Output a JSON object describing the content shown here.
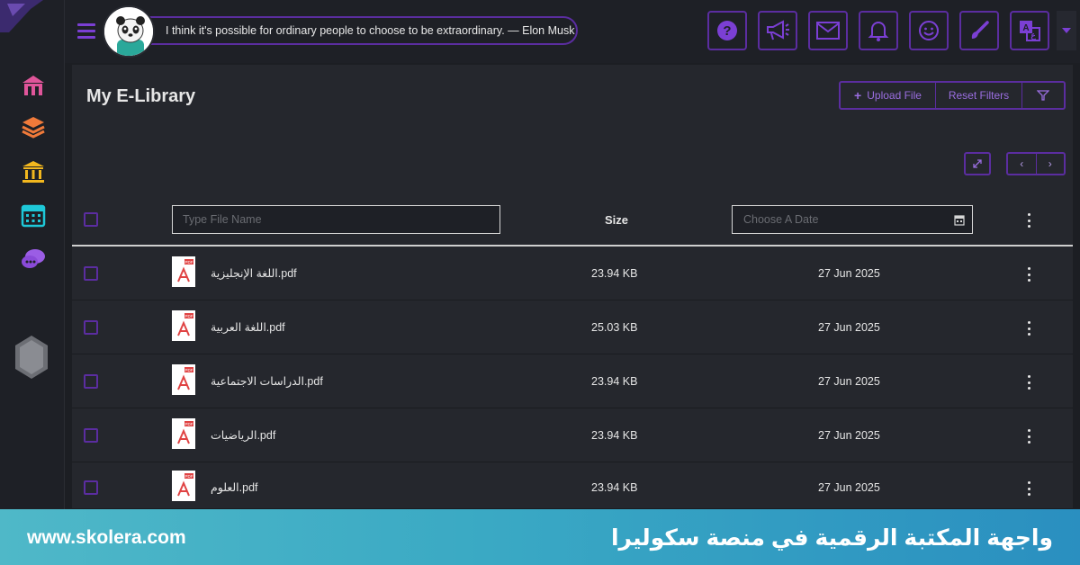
{
  "topbar": {
    "quote": "I think it's possible for ordinary people to choose to be extraordinary. — Elon Musk",
    "icons": [
      "help-icon",
      "megaphone-icon",
      "mail-icon",
      "bell-icon",
      "smiley-icon",
      "brush-icon",
      "translate-icon"
    ]
  },
  "sidebar": {
    "items": [
      "home-icon",
      "layers-icon",
      "institution-icon",
      "calendar-icon",
      "chat-icon"
    ]
  },
  "library": {
    "title": "My E-Library",
    "upload_label": "Upload File",
    "reset_label": "Reset Filters",
    "pager_prev": "‹",
    "pager_next": "›",
    "name_placeholder": "Type File Name",
    "size_header": "Size",
    "date_placeholder": "Choose A Date",
    "rows": [
      {
        "name": "اللغة الإنجليزية.pdf",
        "size": "23.94 KB",
        "date": "27 Jun 2025"
      },
      {
        "name": "اللغة العربية.pdf",
        "size": "25.03 KB",
        "date": "27 Jun 2025"
      },
      {
        "name": "الدراسات الاجتماعية.pdf",
        "size": "23.94 KB",
        "date": "27 Jun 2025"
      },
      {
        "name": "الرياضيات.pdf",
        "size": "23.94 KB",
        "date": "27 Jun 2025"
      },
      {
        "name": "العلوم.pdf",
        "size": "23.94 KB",
        "date": "27 Jun 2025"
      }
    ]
  },
  "banner": {
    "url": "www.skolera.com",
    "title": "واجهة المكتبة الرقمية في منصة سكوليرا"
  },
  "colors": {
    "accent": "#5b2da0",
    "accent_light": "#9a6ee0",
    "banner_start": "#4fb8c8",
    "banner_end": "#2a8fc0"
  }
}
